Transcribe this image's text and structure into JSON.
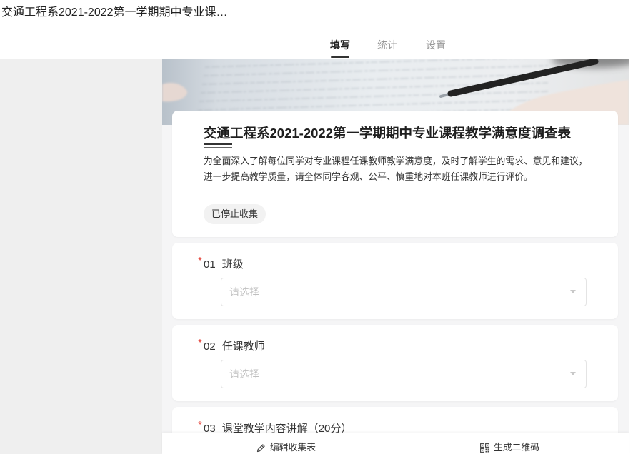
{
  "header": {
    "title": "交通工程系2021-2022第一学期期中专业课…",
    "tabs": [
      {
        "label": "填写",
        "active": true
      },
      {
        "label": "统计",
        "active": false
      },
      {
        "label": "设置",
        "active": false
      }
    ]
  },
  "form": {
    "title": "交通工程系2021-2022第一学期期中专业课程教学满意度调查表",
    "description": "为全面深入了解每位同学对专业课程任课教师教学满意度，及时了解学生的需求、意见和建议，进一步提高教学质量，请全体同学客观、公平、慎重地对本班任课教师进行评价。",
    "status_badge": "已停止收集",
    "questions": [
      {
        "required_mark": "*",
        "number": "01",
        "label": "班级",
        "placeholder": "请选择",
        "dropdown_icon": "chevron-down-icon"
      },
      {
        "required_mark": "*",
        "number": "02",
        "label": "任课教师",
        "placeholder": "请选择",
        "dropdown_icon": "chevron-down-icon"
      },
      {
        "required_mark": "*",
        "number": "03",
        "label": "课堂教学内容讲解（20分）"
      }
    ]
  },
  "footer": {
    "edit_icon": "pencil-icon",
    "edit_label": "编辑收集表",
    "qrcode_icon": "qr-code-icon",
    "qrcode_label": "生成二维码"
  },
  "colors": {
    "required_red": "#e5483f",
    "text_primary": "#333333",
    "text_muted": "#999999",
    "placeholder": "#bfbfbf",
    "sidebar_bg": "#efefef",
    "content_bg": "#f5f5f6",
    "card_bg": "#ffffff",
    "badge_bg": "#f2f2f2"
  }
}
